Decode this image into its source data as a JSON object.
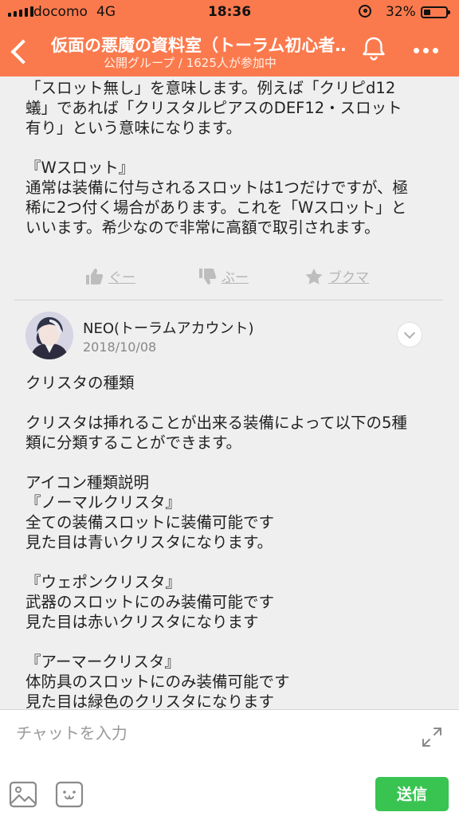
{
  "status_bar": {
    "carrier": "docomo",
    "network": "4G",
    "time": "18:36",
    "battery": "32%"
  },
  "header": {
    "title": "仮面の悪魔の資料室（トーラム初心者…",
    "subtitle": "公開グループ / 1625人が参加中",
    "background_color": "#fb7a4d"
  },
  "previous_post": {
    "body": "「スロット無し」を意味します。例えば「クリピd12\n蟻」であれば「クリスタルピアスのDEF12・スロット\n有り」という意味になります。\n\n『Wスロット』\n通常は装備に付与されるスロットは1つだけですが、極\n稀に2つ付く場合があります。これを「Wスロット」と\nいいます。希少なので非常に高額で取引されます。",
    "reactions": {
      "good": "ぐー",
      "bad": "ぶー",
      "bookmark": "ブクマ"
    }
  },
  "post": {
    "author": "NEO(トーラムアカウント)",
    "date": "2018/10/08",
    "body": "クリスタの種類\n\nクリスタは挿れることが出来る装備によって以下の5種\n類に分類することができます。\n\nアイコン種類説明\n『ノーマルクリスタ』\n全ての装備スロットに装備可能です\n見た目は青いクリスタになります。\n\n『ウェポンクリスタ』\n武器のスロットにのみ装備可能です\n見た目は赤いクリスタになります\n\n『アーマークリスタ』\n体防具のスロットにのみ装備可能です\n見た目は緑色のクリスタになります"
  },
  "composer": {
    "placeholder": "チャットを入力",
    "send_label": "送信",
    "send_color": "#39c452"
  }
}
